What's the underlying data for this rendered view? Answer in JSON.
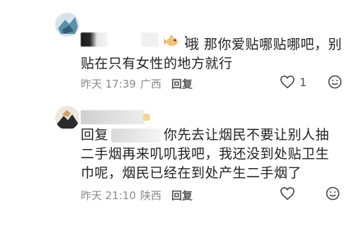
{
  "comments": [
    {
      "text_prefix": "：",
      "text": "哦  那你爱贴哪贴哪吧，别贴在只有女性的地方就行",
      "time": "昨天 17:39",
      "location": "广西",
      "reply_label": "回复",
      "like_count": "1"
    },
    {
      "reply_prefix": "回复",
      "text": "你先去让烟民不要让别人抽二手烟再来叽叽我吧，我还没到处贴卫生巾呢，烟民已经在到处产生二手烟了",
      "time": "昨天 21:10",
      "location": "陕西",
      "reply_label": "回复",
      "like_count": ""
    }
  ],
  "icons": {
    "like": "heart-outline-icon",
    "emoji": "smiley-face-icon"
  },
  "colors": {
    "meta": "#8a8a8a",
    "text": "#222222"
  }
}
